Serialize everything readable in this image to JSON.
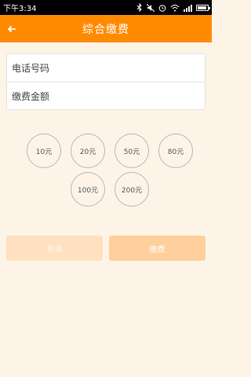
{
  "status_bar": {
    "time": "下午3:34",
    "icons": [
      "bluetooth-icon",
      "mute-icon",
      "alarm-icon",
      "wifi-icon",
      "signal-icon",
      "battery-icon"
    ]
  },
  "app_bar": {
    "back_icon": "arrow-left-icon",
    "title": "综合缴费"
  },
  "form": {
    "phone_placeholder": "电话号码",
    "amount_placeholder": "缴费金额"
  },
  "amounts": [
    "10元",
    "20元",
    "50元",
    "80元",
    "100元",
    "200元"
  ],
  "actions": {
    "query_label": "查询",
    "pay_label": "缴费"
  },
  "colors": {
    "accent": "#ff8a00",
    "background": "#fdf4e7",
    "query_button": "#ffe0c0",
    "pay_button": "#ffcf9c"
  }
}
